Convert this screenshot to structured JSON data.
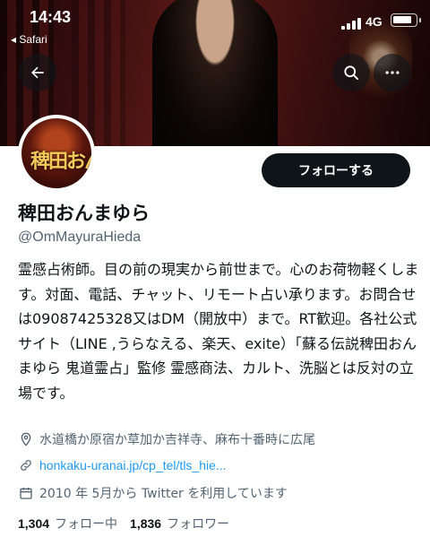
{
  "status_bar": {
    "time": "14:43",
    "back_app": "◂ Safari",
    "network": "4G",
    "battery_level": 0.85
  },
  "header": {
    "back_icon": "arrow-left-icon",
    "search_icon": "search-icon",
    "more_icon": "more-horizontal-icon"
  },
  "profile": {
    "avatar_logo": "稗田おんまゆら",
    "follow_label": "フォローする",
    "display_name": "稗田おんまゆら",
    "handle": "@OmMayuraHieda",
    "bio": "霊感占術師。目の前の現実から前世まで。心のお荷物軽くします。対面、電話、チャット、リモート占い承ります。お問合せは09087425328又はDM（開放中）まで。RT歓迎。各社公式サイト（LINE ,うらなえる、楽天、exite）「蘇る伝説稗田おんまゆら 鬼道霊占」監修 霊感商法、カルト、洗脳とは反対の立場です。",
    "location": "水道橋か原宿か草加か吉祥寺、麻布十番時に広尾",
    "url": "honkaku-uranai.jp/cp_tel/tls_hie...",
    "joined": "2010 年 5月から Twitter を利用しています",
    "following_count": "1,304",
    "following_label": "フォロー中",
    "followers_count": "1,836",
    "followers_label": "フォロワー"
  },
  "colors": {
    "accent": "#1d9bf0",
    "text": "#0f1419",
    "secondary": "#536471"
  }
}
